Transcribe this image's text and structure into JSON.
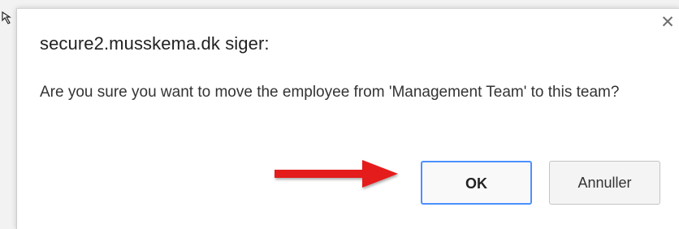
{
  "dialog": {
    "title": "secure2.musskema.dk siger:",
    "message": "Are you sure you want to move the employee from 'Management Team' to this team?",
    "close_icon": "close-icon",
    "ok_label": "OK",
    "cancel_label": "Annuller"
  },
  "annotation": {
    "arrow_color": "#e51f1f",
    "arrow_icon": "red-arrow-icon"
  },
  "colors": {
    "focus_border": "#4d90fe"
  }
}
